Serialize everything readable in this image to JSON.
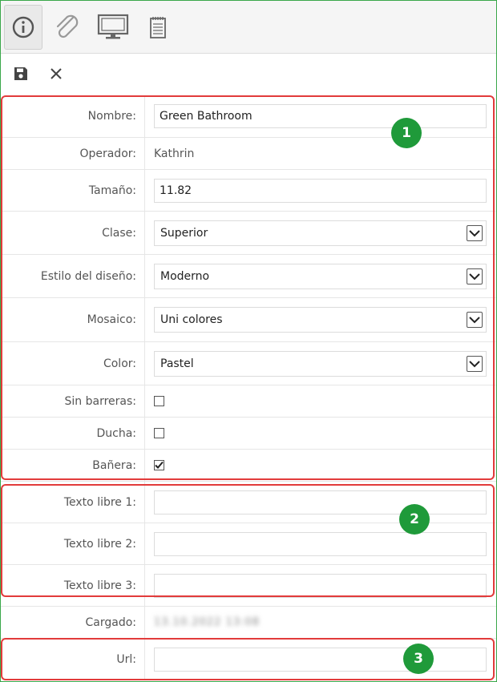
{
  "tabs": [
    {
      "name": "info-icon",
      "active": true
    },
    {
      "name": "paperclip-icon",
      "active": false
    },
    {
      "name": "monitor-icon",
      "active": false
    },
    {
      "name": "notepad-icon",
      "active": false
    }
  ],
  "actions": [
    {
      "name": "save-icon"
    },
    {
      "name": "close-icon"
    }
  ],
  "form": {
    "nombre": {
      "label": "Nombre:",
      "value": "Green Bathroom"
    },
    "operador": {
      "label": "Operador:",
      "value": "Kathrin"
    },
    "tamano": {
      "label": "Tamaño:",
      "value": "11.82"
    },
    "clase": {
      "label": "Clase:",
      "value": "Superior"
    },
    "estilo": {
      "label": "Estilo del diseño:",
      "value": "Moderno"
    },
    "mosaico": {
      "label": "Mosaico:",
      "value": "Uni colores"
    },
    "color": {
      "label": "Color:",
      "value": "Pastel"
    },
    "sin_barreras": {
      "label": "Sin barreras:",
      "checked": false
    },
    "ducha": {
      "label": "Ducha:",
      "checked": false
    },
    "banera": {
      "label": "Bañera:",
      "checked": true
    },
    "texto1": {
      "label": "Texto libre 1:",
      "value": ""
    },
    "texto2": {
      "label": "Texto libre 2:",
      "value": ""
    },
    "texto3": {
      "label": "Texto libre 3:",
      "value": ""
    },
    "cargado": {
      "label": "Cargado:",
      "value": "13.10.2022 13:08"
    },
    "url": {
      "label": "Url:",
      "value": ""
    }
  },
  "badges": [
    "1",
    "2",
    "3"
  ],
  "colors": {
    "callout": "#e23b3b",
    "badge": "#1f9a3a",
    "frame": "#3aa84a"
  }
}
